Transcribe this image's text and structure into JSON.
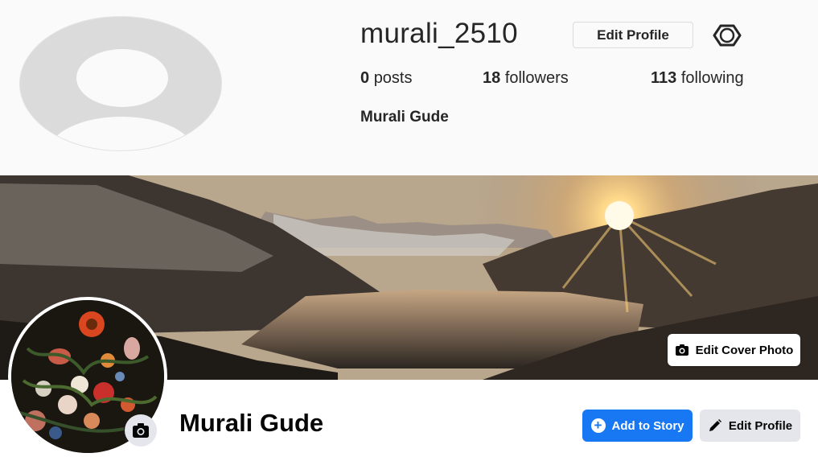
{
  "ig_header": {
    "username": "murali_2510",
    "edit_profile_label": "Edit Profile",
    "stats": {
      "posts_count": "0",
      "posts_label": "posts",
      "followers_count": "18",
      "followers_label": "followers",
      "following_count": "113",
      "following_label": "following"
    },
    "full_name": "Murali Gude"
  },
  "cover": {
    "edit_cover_label": "Edit Cover Photo"
  },
  "profile": {
    "name": "Murali Gude",
    "add_story_label": "Add to Story",
    "edit_profile_label": "Edit Profile"
  },
  "icons": {
    "settings": "gear-icon",
    "camera": "camera-icon",
    "add": "plus-circle-icon",
    "edit": "pencil-icon"
  },
  "colors": {
    "primary_blue": "#1877f2",
    "secondary_button": "#e4e6eb",
    "text_dark": "#262626"
  }
}
